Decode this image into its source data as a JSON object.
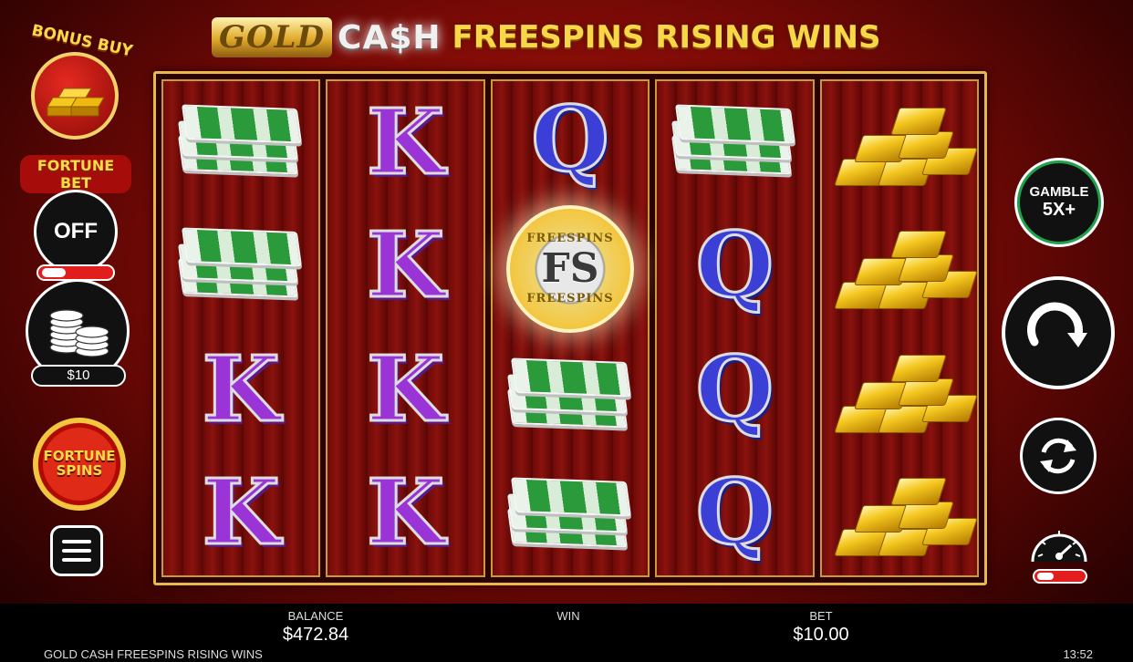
{
  "title": {
    "gold": "GOLD",
    "cash": "CA$H",
    "rest": "FREESPINS RISING WINS"
  },
  "reels": [
    [
      "money",
      "money",
      "K",
      "K"
    ],
    [
      "K",
      "K",
      "K",
      "K"
    ],
    [
      "Q",
      "FS",
      "money",
      "money"
    ],
    [
      "money",
      "Q",
      "Q",
      "Q"
    ],
    [
      "gold",
      "gold",
      "gold",
      "gold"
    ]
  ],
  "fs_coin": {
    "top": "FREESPINS",
    "center": "FS",
    "bottom": "FREESPINS"
  },
  "left": {
    "bonus_buy": "BONUS BUY",
    "fortune_bet": "FORTUNE BET",
    "fortune_bet_state": "OFF",
    "coin_value": "$10",
    "fortune_spins_line1": "FORTUNE",
    "fortune_spins_line2": "SPINS"
  },
  "right": {
    "gamble_line1": "GAMBLE",
    "gamble_line2": "5X+"
  },
  "footer": {
    "balance_label": "BALANCE",
    "balance_value": "$472.84",
    "win_label": "WIN",
    "win_value": "",
    "bet_label": "BET",
    "bet_value": "$10.00",
    "game_name": "GOLD CASH FREESPINS RISING WINS",
    "clock": "13:52"
  },
  "colors": {
    "background": "#8a0c08",
    "frame_gold": "#e8b84a",
    "k_symbol": "#9a34d6",
    "q_symbol": "#3b3fd6",
    "toggle_red": "#e21d1d",
    "gamble_ring": "#1ea34a"
  },
  "icons": [
    "bonus-buy-gold-bars-icon",
    "coins-stack-icon",
    "menu-icon",
    "spin-icon",
    "autoplay-icon",
    "speedometer-icon"
  ]
}
